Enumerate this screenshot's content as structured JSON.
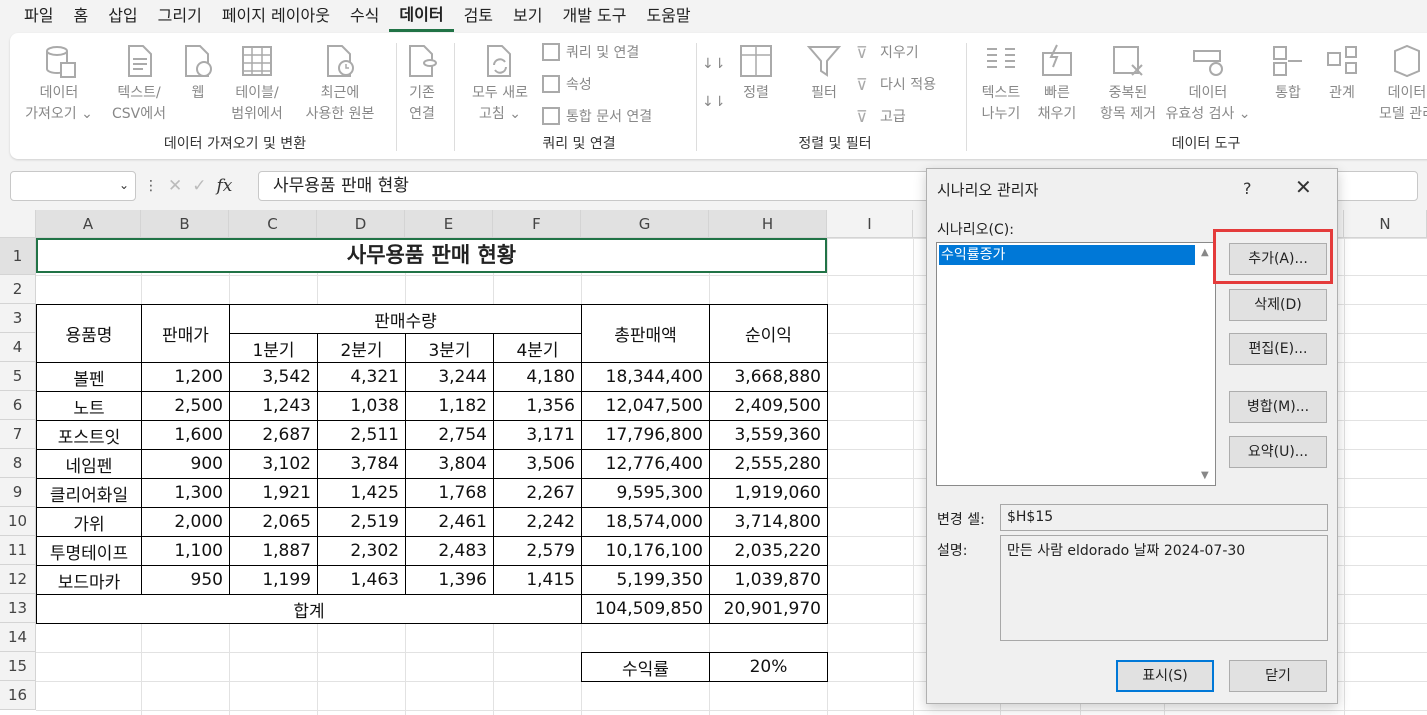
{
  "menu": [
    "파일",
    "홈",
    "삽입",
    "그리기",
    "페이지 레이아웃",
    "수식",
    "데이터",
    "검토",
    "보기",
    "개발 도구",
    "도움말"
  ],
  "active_menu_index": 6,
  "ribbon": {
    "get_data": {
      "label1": "데이터",
      "label2": "가져오기 ⌄"
    },
    "text_csv": {
      "label1": "텍스트/",
      "label2": "CSV에서"
    },
    "web": {
      "label1": "웹"
    },
    "table_range": {
      "label1": "테이블/",
      "label2": "범위에서"
    },
    "recent": {
      "label1": "최근에",
      "label2": "사용한 원본"
    },
    "existing": {
      "label1": "기존",
      "label2": "연결"
    },
    "group1_label": "데이터 가져오기 및 변환",
    "refresh_all": {
      "label1": "모두 새로",
      "label2": "고침 ⌄"
    },
    "queries_connections": "쿼리 및 연결",
    "properties": "속성",
    "edit_links": "통합 문서 연결",
    "group2_label": "쿼리 및 연결",
    "sort": "정렬",
    "filter": "필터",
    "clear": "지우기",
    "reapply": "다시 적용",
    "advanced": "고급",
    "group3_label": "정렬 및 필터",
    "text_to_columns": {
      "label1": "텍스트",
      "label2": "나누기"
    },
    "flash_fill": {
      "label1": "빠른",
      "label2": "채우기"
    },
    "remove_dup": {
      "label1": "중복된",
      "label2": "항목 제거"
    },
    "validation": {
      "label1": "데이터",
      "label2": "유효성 검사 ⌄"
    },
    "consolidate": "통합",
    "relationships": "관계",
    "data_model": {
      "label1": "데이터",
      "label2": "모델 관리"
    },
    "group4_label": "데이터 도구"
  },
  "formula_bar": {
    "name_box": "",
    "fx": "fx",
    "content": "사무용품 판매 현황"
  },
  "columns": [
    "A",
    "B",
    "C",
    "D",
    "E",
    "F",
    "G",
    "H",
    "I",
    "",
    "",
    "",
    "",
    "N"
  ],
  "rows": [
    "1",
    "2",
    "3",
    "4",
    "5",
    "6",
    "7",
    "8",
    "9",
    "10",
    "11",
    "12",
    "13",
    "14",
    "15",
    "16"
  ],
  "sheet": {
    "title": "사무용품 판매 현황",
    "headers": {
      "item": "용품명",
      "price": "판매가",
      "qty": "판매수량",
      "q1": "1분기",
      "q2": "2분기",
      "q3": "3분기",
      "q4": "4분기",
      "total": "총판매액",
      "profit": "순이익"
    },
    "data": [
      [
        "볼펜",
        "1,200",
        "3,542",
        "4,321",
        "3,244",
        "4,180",
        "18,344,400",
        "3,668,880"
      ],
      [
        "노트",
        "2,500",
        "1,243",
        "1,038",
        "1,182",
        "1,356",
        "12,047,500",
        "2,409,500"
      ],
      [
        "포스트잇",
        "1,600",
        "2,687",
        "2,511",
        "2,754",
        "3,171",
        "17,796,800",
        "3,559,360"
      ],
      [
        "네임펜",
        "900",
        "3,102",
        "3,784",
        "3,804",
        "3,506",
        "12,776,400",
        "2,555,280"
      ],
      [
        "클리어화일",
        "1,300",
        "1,921",
        "1,425",
        "1,768",
        "2,267",
        "9,595,300",
        "1,919,060"
      ],
      [
        "가위",
        "2,000",
        "2,065",
        "2,519",
        "2,461",
        "2,242",
        "18,574,000",
        "3,714,800"
      ],
      [
        "투명테이프",
        "1,100",
        "1,887",
        "2,302",
        "2,483",
        "2,579",
        "10,176,100",
        "2,035,220"
      ],
      [
        "보드마카",
        "950",
        "1,199",
        "1,463",
        "1,396",
        "1,415",
        "5,199,350",
        "1,039,870"
      ]
    ],
    "sum_label": "합계",
    "sum_total": "104,509,850",
    "sum_profit": "20,901,970",
    "rate_label": "수익률",
    "rate_value": "20%"
  },
  "dialog": {
    "title": "시나리오 관리자",
    "help": "?",
    "close": "✕",
    "list_label": "시나리오(C):",
    "scenarios": [
      "수익률증가"
    ],
    "btn_add": "추가(A)...",
    "btn_delete": "삭제(D)",
    "btn_edit": "편집(E)...",
    "btn_merge": "병합(M)...",
    "btn_summary": "요약(U)...",
    "changing_label": "변경 셀:",
    "changing_value": "$H$15",
    "desc_label": "설명:",
    "desc_value": "만든 사람 eldorado 날짜 2024-07-30",
    "btn_show": "표시(S)",
    "btn_close": "닫기"
  }
}
